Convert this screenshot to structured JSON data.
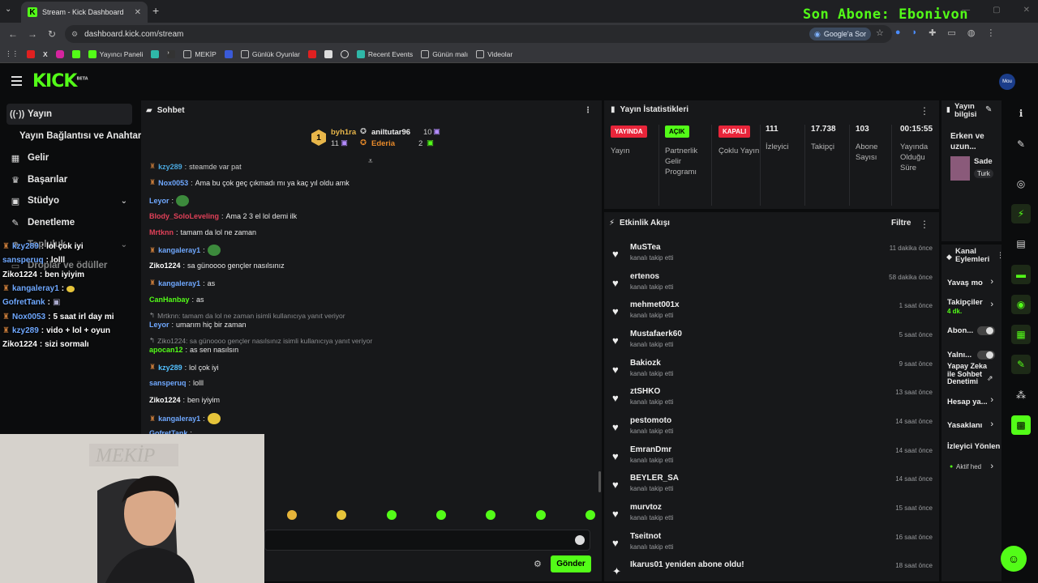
{
  "browser": {
    "tab_title": "Stream - Kick Dashboard",
    "url": "dashboard.kick.com/stream",
    "ask_google": "Google'a Sor",
    "overlay_banner": "Son Abone: Ebonivon",
    "bookmarks": [
      "Yayıncı Paneli",
      "MEKİP",
      "Günlük Oyunlar",
      "Recent Events",
      "Günün malı",
      "Videolar"
    ]
  },
  "sidebar": {
    "items": [
      {
        "label": "Yayın",
        "icon": "broadcast-icon"
      },
      {
        "label": "Yayın Bağlantısı ve Anahtarı",
        "icon": ""
      },
      {
        "label": "Gelir",
        "icon": "revenue-icon"
      },
      {
        "label": "Başarılar",
        "icon": "trophy-icon"
      },
      {
        "label": "Stüdyo",
        "icon": "studio-icon"
      },
      {
        "label": "Denetleme",
        "icon": "wrench-icon"
      },
      {
        "label": "Topluluk",
        "icon": "community-icon"
      },
      {
        "label": "Droplar ve ödüller",
        "icon": "gift-icon"
      }
    ]
  },
  "overlay_chat": [
    {
      "user": "kzy289",
      "text": "lol çok iyi"
    },
    {
      "user": "sansperuq",
      "text": "lolll"
    },
    {
      "user": "Ziko1224",
      "text": "ben iyiyim"
    },
    {
      "user": "kangaleray1",
      "text": ""
    },
    {
      "user": "GofretTank",
      "text": ""
    },
    {
      "user": "Nox0053",
      "text": "5 saat irl day mi"
    },
    {
      "user": "kzy289",
      "text": "vido + lol + oyun"
    },
    {
      "user": "Ziko1224",
      "text": "sizi sormalı"
    }
  ],
  "chat": {
    "title": "Sohbet",
    "pinned": {
      "rank": "1",
      "user1": "byh1ra",
      "user1_count": "11",
      "user2": "aniltutar96",
      "user2_count": "10",
      "user3": "Ederia",
      "user3_count": "2"
    },
    "messages": [
      {
        "user": "kzy289",
        "text": "steamde var pat",
        "color": "#53c0ff"
      },
      {
        "user": "Nox0053",
        "text": "Ama bu çok geç çıkmadı mı ya kaç yıl oldu amk",
        "color": "#6fa8ff"
      },
      {
        "user": "Leyor",
        "text": "",
        "color": "#6fa8ff"
      },
      {
        "user": "Blody_SoloLeveling",
        "text": "Ama 2 3 el lol demi ilk",
        "color": "#e04058"
      },
      {
        "user": "Mrtknn",
        "text": "tamam da lol ne zaman",
        "color": "#e04058"
      },
      {
        "user": "kangaleray1",
        "text": "",
        "color": "#6fa8ff"
      },
      {
        "user": "Ziko1224",
        "text": "sa günoooo gençler nasılsınız",
        "color": "#ffffff"
      },
      {
        "user": "kangaleray1",
        "text": "as",
        "color": "#6fa8ff"
      },
      {
        "user": "CanHanbay",
        "text": "as",
        "color": "#53fc18"
      },
      {
        "reply": "Mrtknn: tamam da lol ne zaman isimli kullanıcıya yanıt veriyor"
      },
      {
        "user": "Leyor",
        "text": "umarım hiç bir zaman",
        "color": "#6fa8ff"
      },
      {
        "reply": "Ziko1224: sa günoooo gençler nasılsınız isimli kullanıcıya yanıt veriyor"
      },
      {
        "user": "apocan12",
        "text": "as sen nasılsın",
        "color": "#53fc18"
      },
      {
        "user": "kzy289",
        "text": "lol çok iyi",
        "color": "#53c0ff"
      },
      {
        "user": "sansperuq",
        "text": "lolll",
        "color": "#6fa8ff"
      },
      {
        "user": "Ziko1224",
        "text": "ben iyiyim",
        "color": "#ffffff"
      },
      {
        "user": "kangaleray1",
        "text": "",
        "color": "#6fa8ff"
      },
      {
        "user": "GofretTank",
        "text": "",
        "color": "#6fa8ff"
      }
    ],
    "input_placeholder": "",
    "send_label": "Gönder"
  },
  "stats": {
    "title": "Yayın İstatistikleri",
    "items": [
      {
        "pill": "YAYINDA",
        "label": "Yayın"
      },
      {
        "pill": "AÇIK",
        "label": "Partnerlik Gelir Programı"
      },
      {
        "pill": "KAPALI",
        "label": "Çoklu Yayın"
      },
      {
        "value": "111",
        "label": "İzleyici"
      },
      {
        "value": "17.738",
        "label": "Takipçi"
      },
      {
        "value": "103",
        "label": "Abone Sayısı"
      },
      {
        "value": "00:15:55",
        "label": "Yayında Olduğu Süre"
      }
    ],
    "colors": {
      "live": "#e8253a",
      "on": "#53fc18",
      "off": "#e8253a"
    }
  },
  "activity": {
    "title": "Etkinlik Akışı",
    "filter": "Filtre",
    "items": [
      {
        "name": "MuSTea",
        "sub": "kanalı takip etti",
        "time": "11 dakika önce"
      },
      {
        "name": "ertenos",
        "sub": "kanalı takip etti",
        "time": "58 dakika önce"
      },
      {
        "name": "mehmet001x",
        "sub": "kanalı takip etti",
        "time": "1 saat önce"
      },
      {
        "name": "Mustafaerk60",
        "sub": "kanalı takip etti",
        "time": "5 saat önce"
      },
      {
        "name": "Bakiozk",
        "sub": "kanalı takip etti",
        "time": "9 saat önce"
      },
      {
        "name": "ztSHKO",
        "sub": "kanalı takip etti",
        "time": "13 saat önce"
      },
      {
        "name": "pestomoto",
        "sub": "kanalı takip etti",
        "time": "14 saat önce"
      },
      {
        "name": "EmranDmr",
        "sub": "kanalı takip etti",
        "time": "14 saat önce"
      },
      {
        "name": "BEYLER_SA",
        "sub": "kanalı takip etti",
        "time": "14 saat önce"
      },
      {
        "name": "murvtoz",
        "sub": "kanalı takip etti",
        "time": "15 saat önce"
      },
      {
        "name": "Tseitnot",
        "sub": "kanalı takip etti",
        "time": "16 saat önce"
      },
      {
        "name": "Ikarus01 yeniden abone oldu!",
        "sub": "",
        "time": "18 saat önce"
      }
    ]
  },
  "info": {
    "title": "Yayın bilgisi",
    "stream_title": "Erken ve uzun...",
    "category": "Sade",
    "tag": "Turk"
  },
  "actions": {
    "title": "Kanal Eylemleri",
    "items": [
      {
        "label": "Yavaş mo"
      },
      {
        "label": "Takipçiler",
        "sub": "4 dk."
      },
      {
        "label": "Abon..."
      },
      {
        "label": "Yalnı..."
      },
      {
        "label": "Yapay Zeka ile Sohbet Denetimi"
      },
      {
        "label": "Hesap ya..."
      },
      {
        "label": "Yasaklanı"
      },
      {
        "label": "İzleyici Yönlen"
      },
      {
        "label": "Aktif hed"
      }
    ]
  }
}
